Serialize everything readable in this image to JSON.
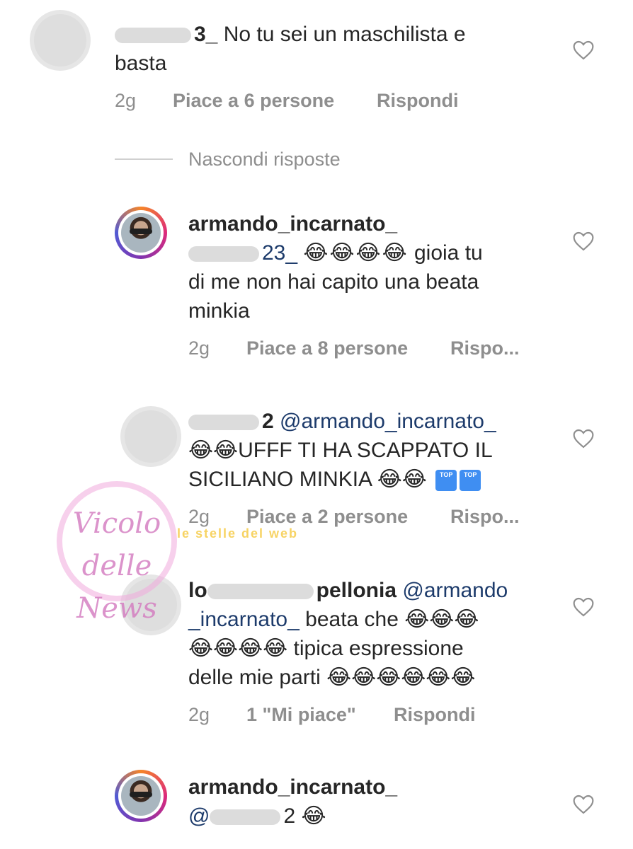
{
  "comments": [
    {
      "username_tail": "3_",
      "text_lines": [
        "No tu sei un maschilista e",
        "basta"
      ],
      "time": "2g",
      "likes": "Piace a 6 persone",
      "reply": "Rispondi"
    },
    {
      "username": "armando_incarnato_",
      "mention_tail": "23_",
      "line1_emojis": "😂😂😂😂",
      "line1_text": "gioia tu",
      "lines": [
        "di me non hai capito una beata",
        "minkia"
      ],
      "time": "2g",
      "likes": "Piace a 8 persone",
      "reply": "Rispo..."
    },
    {
      "username_tail": "2",
      "mention": "@armando_incarnato_",
      "line1": "😂😂UFFF TI HA SCAPPATO IL",
      "line2": "SICILIANO MINKIA 😂😂",
      "top_label": "TOP",
      "time": "2g",
      "likes": "Piace a 2 persone",
      "reply": "Rispo..."
    },
    {
      "username_head": "lo",
      "username_tail": "pellonia",
      "mention_a": "@armando",
      "mention_b": "_incarnato_",
      "line1_text": "beata che 😂😂😂",
      "line2": "😂😂😂😂 tipica espressione",
      "line3": "delle mie parti 😂😂😂😂😂😂",
      "time": "2g",
      "likes": "1 \"Mi piace\"",
      "reply": "Rispondi"
    },
    {
      "username": "armando_incarnato_",
      "mention_head": "@",
      "mention_tail": "2 😂"
    }
  ],
  "hide_replies": "Nascondi risposte",
  "watermark": {
    "main": "Vicolo delle News",
    "sub": "le stelle del web"
  },
  "colors": {
    "text": "#262626",
    "meta": "#8e8e8e",
    "mention": "#1d3b6b"
  }
}
